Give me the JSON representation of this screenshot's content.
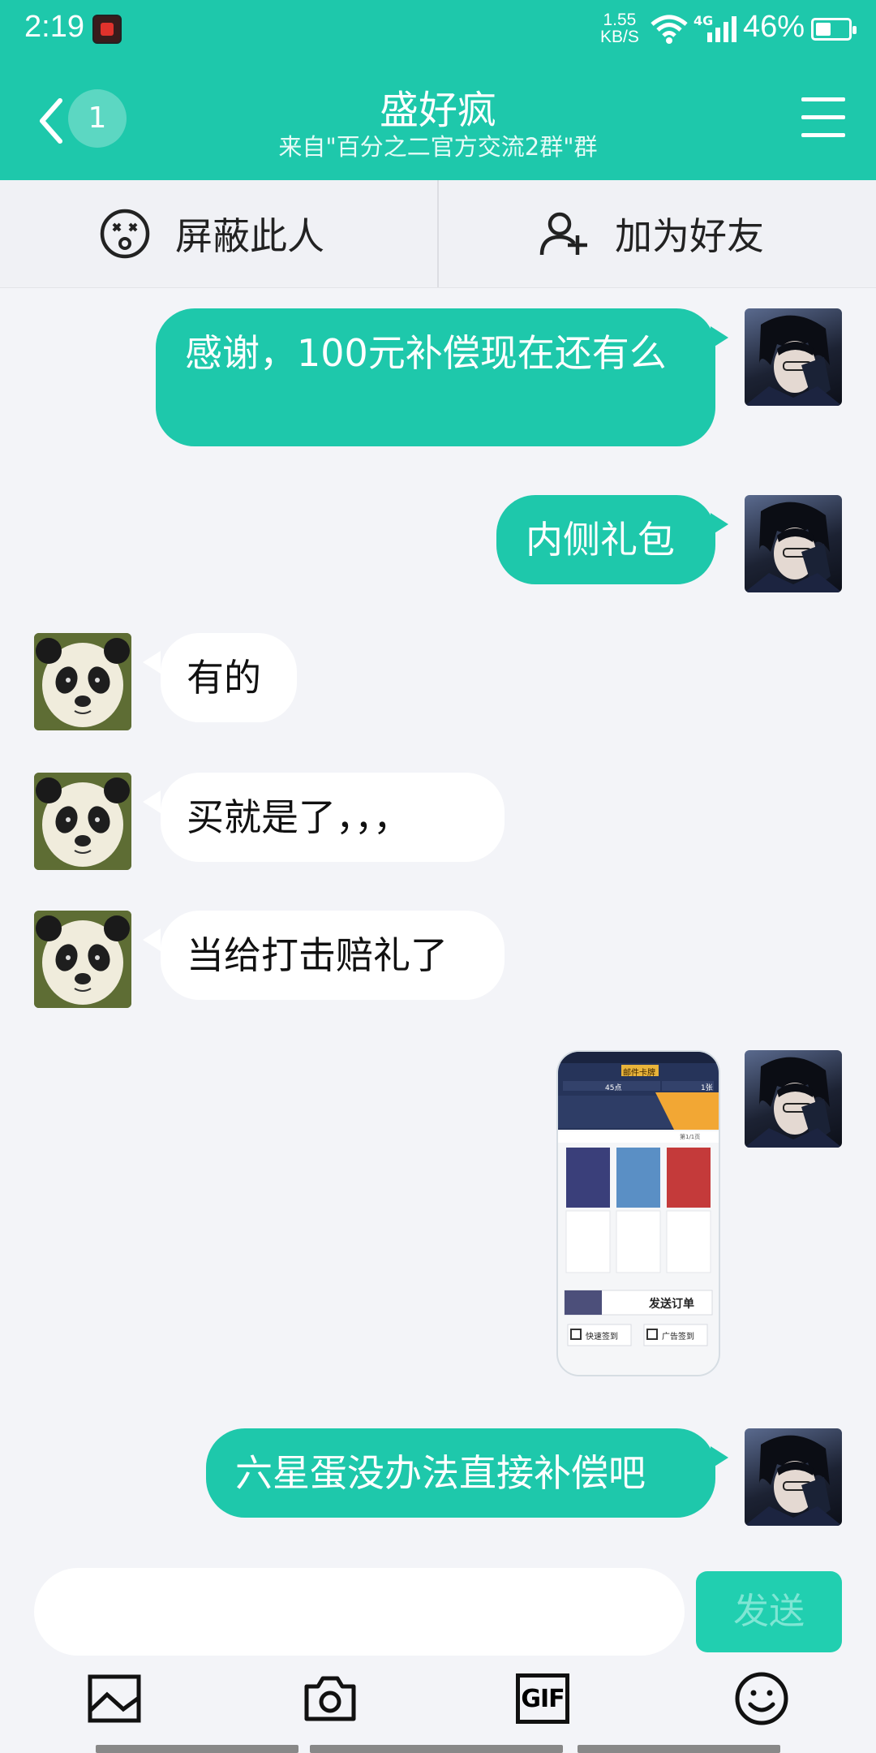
{
  "status": {
    "time": "2:19",
    "speed_value": "1.55",
    "speed_unit": "KB/S",
    "network": "4G",
    "battery": "46%"
  },
  "header": {
    "unread_count": "1",
    "title": "盛好疯",
    "subtitle": "来自\"百分之二官方交流2群\"群"
  },
  "actions": {
    "block_label": "屏蔽此人",
    "add_friend_label": "加为好友"
  },
  "messages": [
    {
      "from": "me",
      "text": "感谢，100元补偿现在还有么"
    },
    {
      "from": "me",
      "text": "内侧礼包"
    },
    {
      "from": "other",
      "text": "有的"
    },
    {
      "from": "other",
      "text": "买就是了，，，"
    },
    {
      "from": "other",
      "text": "当给打击赔礼了"
    },
    {
      "from": "me",
      "type": "image",
      "image": {
        "tab_label": "邮件卡牌",
        "stat_value": "45点",
        "right_value": "1张",
        "pager": "第1/1页",
        "submit_label": "发送订单",
        "option_a": "快速签到",
        "option_b": "广告签到"
      }
    },
    {
      "from": "me",
      "text": "六星蛋没办法直接补偿吧"
    }
  ],
  "composer": {
    "input_value": "",
    "input_placeholder": "",
    "send_label": "发送"
  },
  "toolbar": {
    "gif_label": "GIF"
  },
  "colors": {
    "accent": "#1ec8ab",
    "background": "#f3f4f8"
  }
}
